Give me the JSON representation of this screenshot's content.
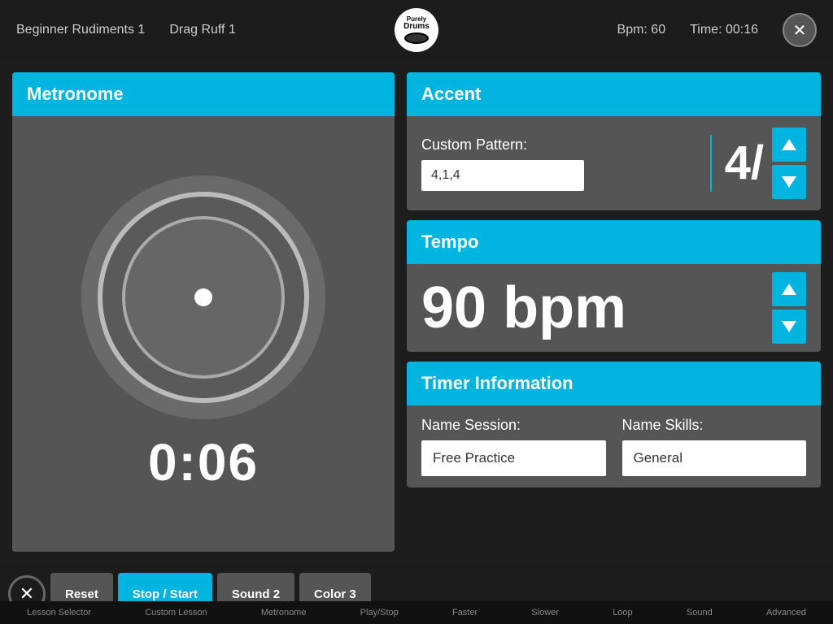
{
  "topbar": {
    "lesson": "Beginner Rudiments 1",
    "exercise": "Drag Ruff 1",
    "logo_top": "Purely",
    "logo_bottom": "Drums",
    "bpm_label": "Bpm: 60",
    "time_label": "Time: 00:16",
    "close_label": "✕"
  },
  "metronome": {
    "title": "Metronome",
    "timer": "0:06"
  },
  "accent": {
    "title": "Accent",
    "custom_pattern_label": "Custom Pattern:",
    "custom_pattern_value": "4,1,4",
    "beat_number": "4/",
    "up_arrow": "▲",
    "down_arrow": "▼"
  },
  "tempo": {
    "title": "Tempo",
    "bpm_value": "90 bpm",
    "up_arrow": "▲",
    "down_arrow": "▼"
  },
  "timer_info": {
    "title": "Timer Information",
    "name_session_label": "Name Session:",
    "name_session_value": "Free Practice",
    "name_skills_label": "Name Skills:",
    "name_skills_value": "General"
  },
  "bottom_controls": {
    "close_btn": "✕",
    "reset_btn": "Reset",
    "stop_start_btn": "Stop / Start",
    "sound_btn": "Sound 2",
    "color_btn": "Color 3"
  },
  "bottom_nav": {
    "tabs": [
      "Lesson Selector",
      "Custom Lesson",
      "Metronome",
      "Play/Stop",
      "Faster",
      "Slower",
      "Loop",
      "Sound",
      "Advanced"
    ]
  }
}
